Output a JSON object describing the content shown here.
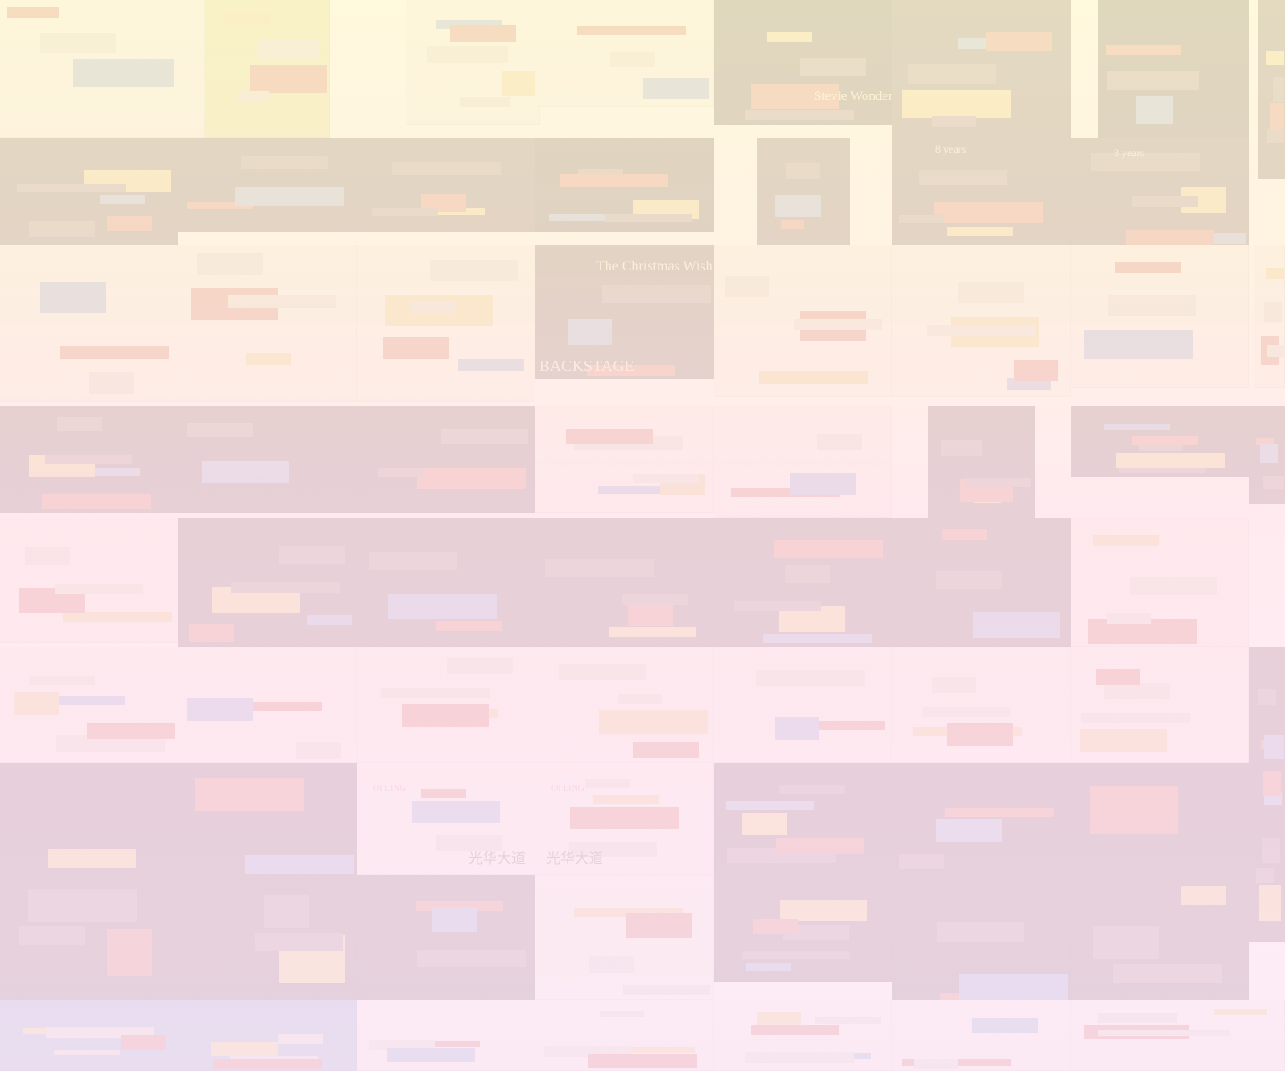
{
  "background": {
    "overlay_colors": [
      "#fff8d7",
      "#ffe8ec",
      "#fce9f6"
    ],
    "tile_palette": {
      "dark": "#3b2230",
      "darker": "#241820",
      "light": "#f4ede8",
      "red": "#c0392b",
      "gold": "#e1b94a",
      "yellow_green": "#d4d25a",
      "blue": "#5e7fc8"
    }
  },
  "texts": {
    "stevie": "Stevie Wonder",
    "christmas_title": "The Christmas Wish",
    "backstage": "BACKSTAGE",
    "years_1": "8 years",
    "years_2": "8 years",
    "chinese_1": "光华大道",
    "chinese_2": "光华大道",
    "brand_1": "OI LING",
    "brand_2": "OI LING"
  }
}
